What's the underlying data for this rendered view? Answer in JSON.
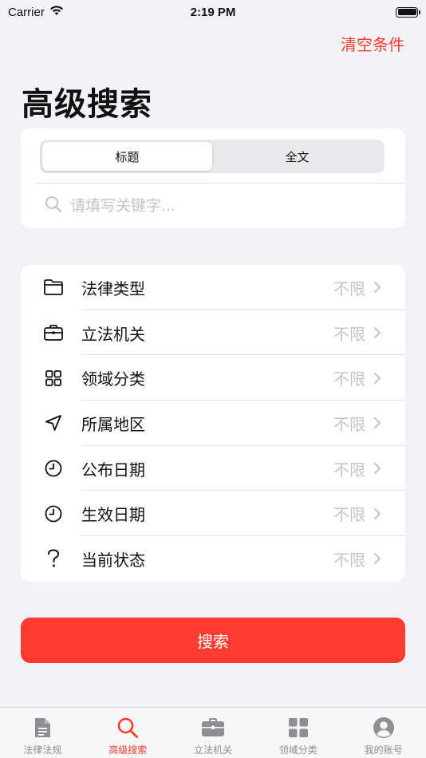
{
  "status_bar": {
    "carrier": "Carrier",
    "time": "2:19 PM"
  },
  "header": {
    "clear_label": "清空条件",
    "title": "高级搜索"
  },
  "search_mode": {
    "segments": [
      {
        "label": "标题",
        "selected": true
      },
      {
        "label": "全文",
        "selected": false
      }
    ]
  },
  "search": {
    "placeholder": "请填写关键字..."
  },
  "filters": [
    {
      "label": "法律类型",
      "value": "不限",
      "icon": "folder-icon"
    },
    {
      "label": "立法机关",
      "value": "不限",
      "icon": "briefcase-icon"
    },
    {
      "label": "领域分类",
      "value": "不限",
      "icon": "grid-icon"
    },
    {
      "label": "所属地区",
      "value": "不限",
      "icon": "location-arrow-icon"
    },
    {
      "label": "公布日期",
      "value": "不限",
      "icon": "clock-icon"
    },
    {
      "label": "生效日期",
      "value": "不限",
      "icon": "clock-icon"
    },
    {
      "label": "当前状态",
      "value": "不限",
      "icon": "question-icon"
    }
  ],
  "search_button": {
    "label": "搜索"
  },
  "tabs": [
    {
      "label": "法律法规",
      "icon": "document-icon",
      "active": false
    },
    {
      "label": "高级搜索",
      "icon": "search-icon",
      "active": true
    },
    {
      "label": "立法机关",
      "icon": "briefcase-icon",
      "active": false
    },
    {
      "label": "领域分类",
      "icon": "grid-icon",
      "active": false
    },
    {
      "label": "我的账号",
      "icon": "person-icon",
      "active": false
    }
  ],
  "colors": {
    "accent": "#ff3b30",
    "background": "#f2f2f7",
    "inactive": "#8e8e93",
    "placeholder": "#c4c4c7"
  }
}
